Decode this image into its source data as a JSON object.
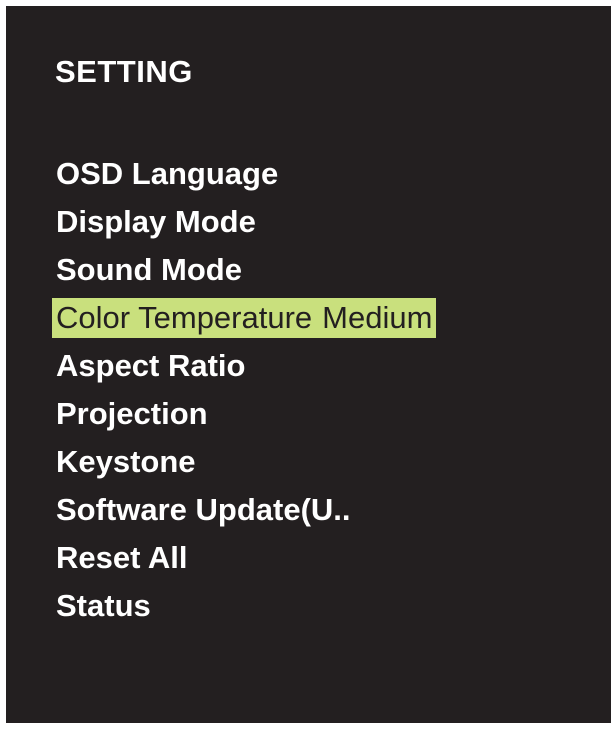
{
  "menu": {
    "title": "SETTING",
    "items": [
      {
        "label": "OSD Language"
      },
      {
        "label": "Display Mode"
      },
      {
        "label": "Sound Mode"
      },
      {
        "label": "Color Temperature",
        "value": "Medium",
        "selected": true
      },
      {
        "label": "Aspect Ratio"
      },
      {
        "label": "Projection"
      },
      {
        "label": "Keystone"
      },
      {
        "label": "Software Update(U.."
      },
      {
        "label": "Reset All"
      },
      {
        "label": "Status"
      }
    ]
  },
  "colors": {
    "panel_background": "#231f20",
    "text": "#ffffff",
    "highlight": "#c9e07d",
    "highlight_text": "#231f20"
  }
}
